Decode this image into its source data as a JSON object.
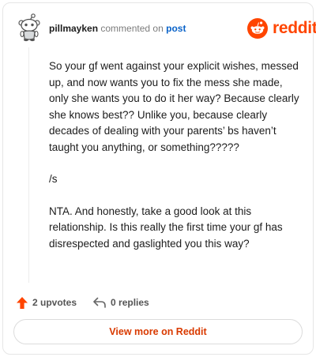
{
  "comment": {
    "username": "pillmayken",
    "verb": "commented on",
    "post_link": "post",
    "paragraphs": [
      "So your gf went against your explicit wishes, messed up, and now wants you to fix the mess she made, only she wants you to do it her way? Because clearly she knows best?? Unlike you, because clearly decades of dealing with your parents’ bs haven’t taught you anything, or something?????",
      "/s",
      "NTA. And honestly, take a good look at this relationship. Is this really the first time your gf has disrespected and gaslighted you this way?"
    ]
  },
  "brand": {
    "wordmark": "reddit",
    "icon": "reddit-logo-icon",
    "color": "#ff4500"
  },
  "actions": {
    "upvotes_label": "2 upvotes",
    "upvote_icon": "upvote-arrow-icon",
    "upvote_color": "#ff4500",
    "replies_label": "0 replies",
    "reply_icon": "reply-arrow-icon"
  },
  "footer": {
    "button_label": "View more on Reddit",
    "button_color": "#d93a00"
  }
}
